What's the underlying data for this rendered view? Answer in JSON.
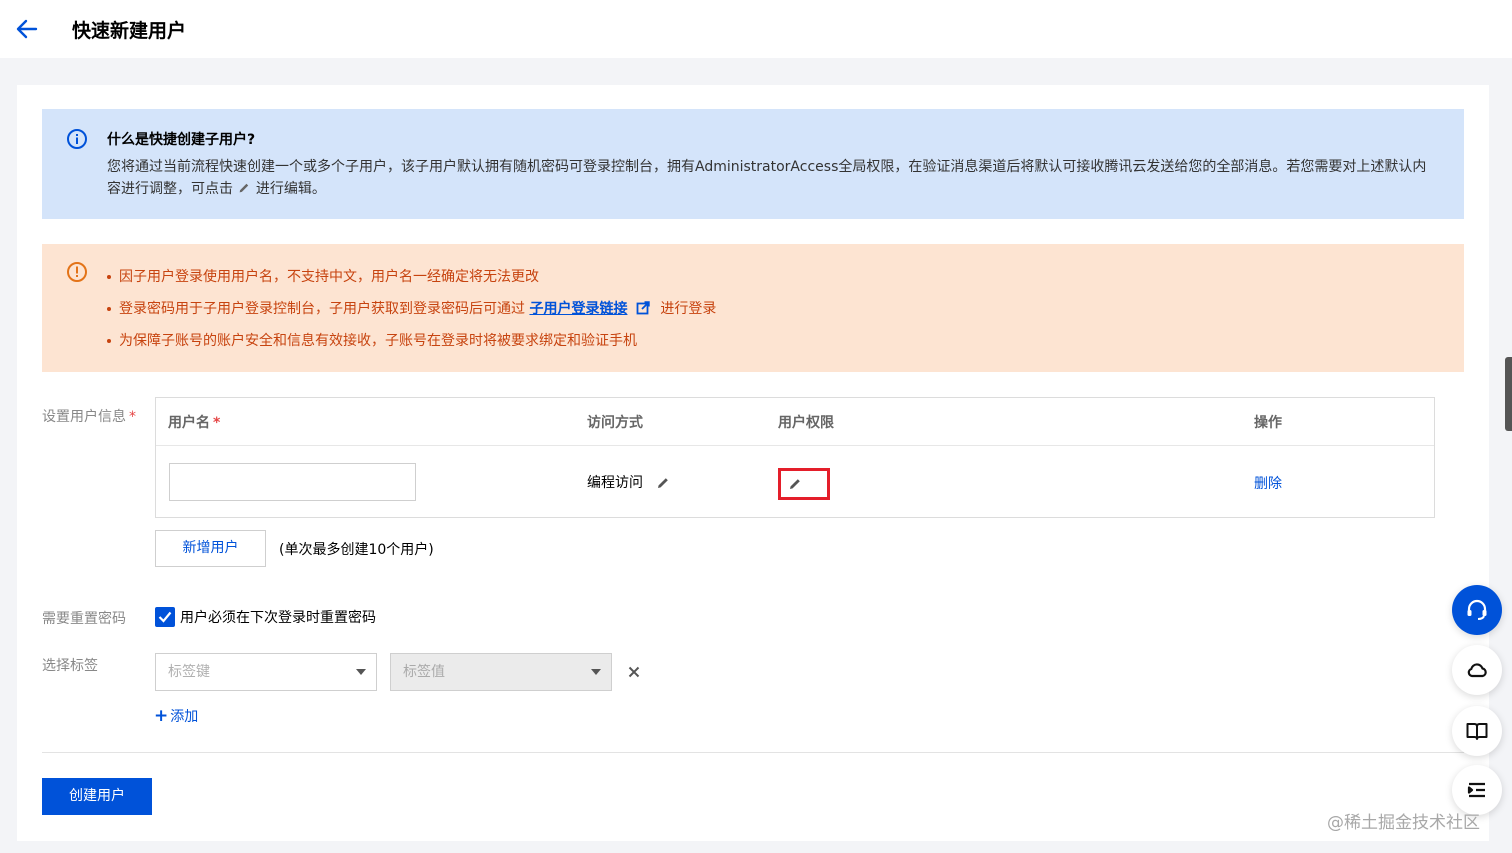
{
  "header": {
    "title": "快速新建用户"
  },
  "info_alert": {
    "title": "什么是快捷创建子用户?",
    "text_before_icon": "您将通过当前流程快速创建一个或多个子用户，该子用户默认拥有随机密码可登录控制台，拥有AdministratorAccess全局权限，在验证消息渠道后将默认可接收腾讯云发送给您的全部消息。若您需要对上述默认内容进行调整，可点击",
    "text_after_icon": "进行编辑。"
  },
  "warning_alert": {
    "items": [
      {
        "text": "因子用户登录使用用户名，不支持中文，用户名一经确定将无法更改"
      },
      {
        "text_before": "登录密码用于子用户登录控制台，子用户获取到登录密码后可通过",
        "link": "子用户登录链接",
        "text_after": "进行登录"
      },
      {
        "text": "为保障子账号的账户安全和信息有效接收，子账号在登录时将被要求绑定和验证手机"
      }
    ]
  },
  "form": {
    "user_info_label": "设置用户信息",
    "required_mark": "*",
    "table": {
      "columns": {
        "username": "用户名",
        "access": "访问方式",
        "permission": "用户权限",
        "action": "操作"
      },
      "row": {
        "username_value": "",
        "access": "编程访问",
        "permission": "",
        "action": "删除"
      }
    },
    "add_user_button": "新增用户",
    "add_user_hint": "(单次最多创建10个用户)",
    "reset_password_label": "需要重置密码",
    "reset_password_checkbox": {
      "label": "用户必须在下次登录时重置密码",
      "checked": true
    },
    "tags_label": "选择标签",
    "tag_key_placeholder": "标签键",
    "tag_value_placeholder": "标签值",
    "add_tag_plus": "+",
    "add_tag": "添加",
    "submit_button": "创建用户"
  },
  "watermark": "@稀土掘金技术社区",
  "colors": {
    "primary": "#0052d9",
    "info_bg": "#d4e4fa",
    "warning_bg": "#fde4d2",
    "warning_text": "#c7430f",
    "highlight": "#e41e2a"
  },
  "icons": [
    "back-arrow-icon",
    "info-icon",
    "pencil-icon",
    "warning-icon",
    "external-link-icon",
    "checkmark-icon",
    "close-icon",
    "headset-icon",
    "cloud-icon",
    "book-icon",
    "list-icon"
  ]
}
